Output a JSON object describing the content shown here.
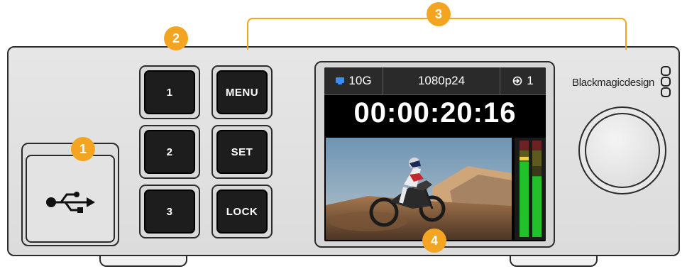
{
  "callouts": [
    "1",
    "2",
    "3",
    "4"
  ],
  "buttons": {
    "b1": "1",
    "b2": "2",
    "b3": "3",
    "menu": "MENU",
    "set": "SET",
    "lock": "LOCK"
  },
  "lcd": {
    "network": "10G",
    "format": "1080p24",
    "input": "1",
    "timecode": "00:00:20:16",
    "audio_levels": [
      0.78,
      0.63
    ]
  },
  "brand": "Blackmagicdesign",
  "colors": {
    "callout": "#f3a521",
    "meter_green": "#22c02a",
    "meter_yellow": "#f0d43a"
  },
  "icons": [
    "usb-icon",
    "network-icon",
    "input-icon",
    "brand-logo-icon"
  ]
}
